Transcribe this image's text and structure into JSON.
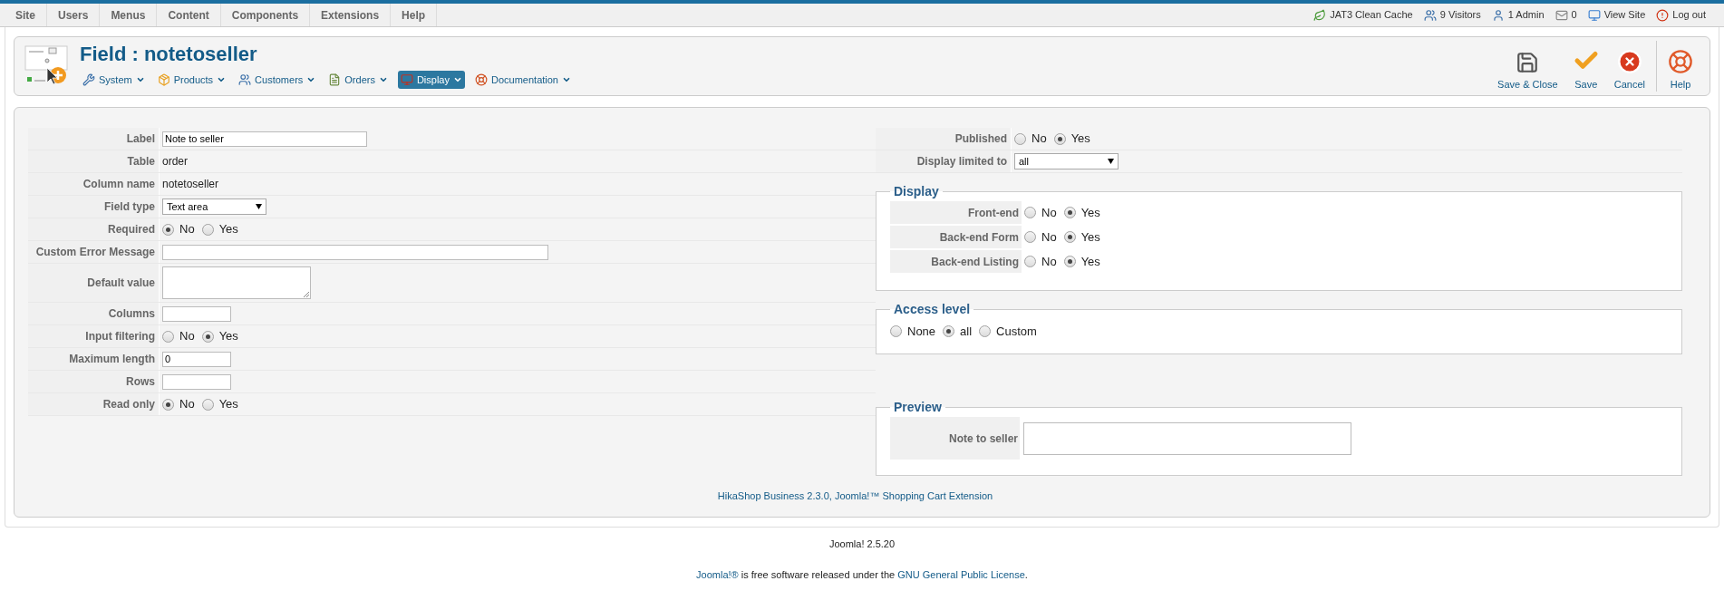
{
  "top_menu": [
    {
      "label": "Site"
    },
    {
      "label": "Users"
    },
    {
      "label": "Menus"
    },
    {
      "label": "Content"
    },
    {
      "label": "Components"
    },
    {
      "label": "Extensions"
    },
    {
      "label": "Help"
    }
  ],
  "status_items": [
    {
      "label": "JAT3 Clean Cache"
    },
    {
      "label": "9 Visitors"
    },
    {
      "label": "1 Admin"
    },
    {
      "label": "0"
    },
    {
      "label": "View Site"
    },
    {
      "label": "Log out"
    }
  ],
  "title": "Field : notetoseller",
  "submenu": [
    {
      "label": "System",
      "selected": false
    },
    {
      "label": "Products",
      "selected": false
    },
    {
      "label": "Customers",
      "selected": false
    },
    {
      "label": "Orders",
      "selected": false
    },
    {
      "label": "Display",
      "selected": true
    },
    {
      "label": "Documentation",
      "selected": false
    }
  ],
  "toolbar": [
    {
      "label": "Save & Close"
    },
    {
      "label": "Save"
    },
    {
      "label": "Cancel"
    },
    {
      "label": "Help"
    }
  ],
  "left_fields": [
    {
      "label": "Label",
      "kind": "input",
      "value": "Note to seller"
    },
    {
      "label": "Table",
      "kind": "text",
      "value": "order"
    },
    {
      "label": "Column name",
      "kind": "text",
      "value": "notetoseller"
    },
    {
      "label": "Field type",
      "kind": "select",
      "value": "Text area"
    },
    {
      "label": "Required",
      "kind": "radio",
      "options": [
        {
          "label": "No",
          "selected": true
        },
        {
          "label": "Yes",
          "selected": false
        }
      ]
    },
    {
      "label": "Custom Error Message",
      "kind": "long_input"
    },
    {
      "label": "Default value",
      "kind": "textarea"
    },
    {
      "label": "Columns",
      "kind": "short_input"
    },
    {
      "label": "Input filtering",
      "kind": "radio",
      "options": [
        {
          "label": "No",
          "selected": false
        },
        {
          "label": "Yes",
          "selected": true
        }
      ]
    },
    {
      "label": "Maximum length",
      "kind": "short_input",
      "value": "0"
    },
    {
      "label": "Rows",
      "kind": "short_input"
    },
    {
      "label": "Read only",
      "kind": "radio",
      "options": [
        {
          "label": "No",
          "selected": true
        },
        {
          "label": "Yes",
          "selected": false
        }
      ]
    }
  ],
  "right_fields": [
    {
      "label": "Published",
      "kind": "radio",
      "options": [
        {
          "label": "No",
          "selected": false
        },
        {
          "label": "Yes",
          "selected": true
        }
      ]
    },
    {
      "label": "Display limited to",
      "kind": "select",
      "value": "all"
    }
  ],
  "display": {
    "legend": "Display",
    "rows": [
      {
        "label": "Front-end",
        "options": [
          {
            "label": "No",
            "selected": false
          },
          {
            "label": "Yes",
            "selected": true
          }
        ]
      },
      {
        "label": "Back-end Form",
        "options": [
          {
            "label": "No",
            "selected": false
          },
          {
            "label": "Yes",
            "selected": true
          }
        ]
      },
      {
        "label": "Back-end Listing",
        "options": [
          {
            "label": "No",
            "selected": false
          },
          {
            "label": "Yes",
            "selected": true
          }
        ]
      }
    ]
  },
  "access_level": {
    "legend": "Access level",
    "options": [
      {
        "label": "None",
        "selected": false
      },
      {
        "label": "all",
        "selected": true
      },
      {
        "label": "Custom",
        "selected": false
      }
    ]
  },
  "preview": {
    "legend": "Preview",
    "label": "Note to seller"
  },
  "credit": "HikaShop Business 2.3.0, Joomla!™ Shopping Cart Extension",
  "version": "Joomla! 2.5.20",
  "license": [
    {
      "text": "Joomla!®",
      "link": true
    },
    {
      "text": " is free software released under the ",
      "link": false
    },
    {
      "text": "GNU General Public License",
      "link": true
    },
    {
      "text": ".",
      "link": false
    }
  ]
}
